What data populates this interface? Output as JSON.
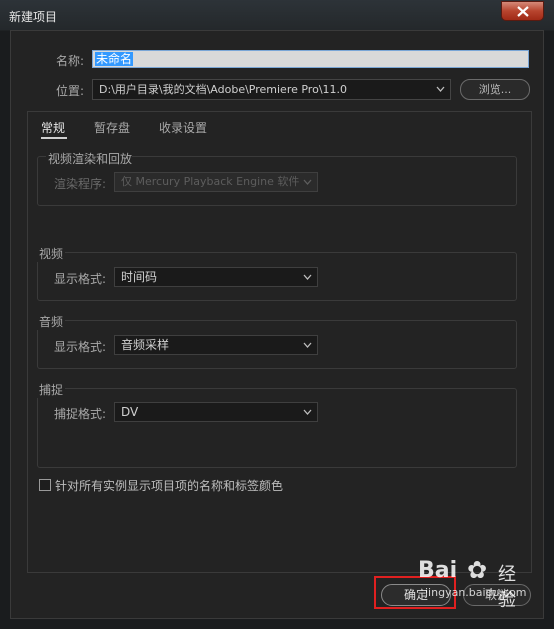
{
  "window": {
    "title": "新建项目"
  },
  "fields": {
    "name_label": "名称:",
    "name_value": "未命名",
    "location_label": "位置:",
    "location_value": "D:\\用户目录\\我的文档\\Adobe\\Premiere Pro\\11.0",
    "browse_label": "浏览..."
  },
  "tabs": [
    {
      "label": "常规"
    },
    {
      "label": "暂存盘"
    },
    {
      "label": "收录设置"
    }
  ],
  "groups": {
    "render": {
      "title": "视频渲染和回放",
      "renderer_label": "渲染程序:",
      "renderer_value": "仅 Mercury Playback Engine 软件"
    },
    "video": {
      "title": "视频",
      "format_label": "显示格式:",
      "format_value": "时间码"
    },
    "audio": {
      "title": "音频",
      "format_label": "显示格式:",
      "format_value": "音频采样"
    },
    "capture": {
      "title": "捕捉",
      "format_label": "捕捉格式:",
      "format_value": "DV"
    }
  },
  "checkbox": {
    "label": "针对所有实例显示项目项的名称和标签颜色",
    "checked": false
  },
  "buttons": {
    "ok": "确定",
    "cancel": "取消"
  },
  "watermark": {
    "logo": "Bai",
    "logo_suffix": "经验",
    "url": "jingyan.baidu.com"
  },
  "colors": {
    "highlight": "#e02020",
    "selection": "#3399ff"
  }
}
